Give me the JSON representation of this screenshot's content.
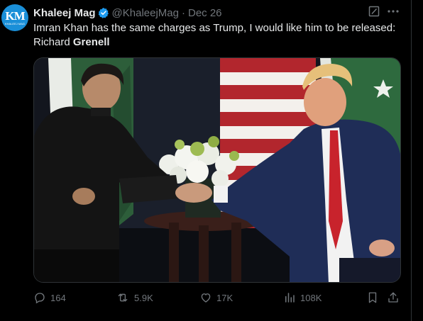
{
  "author": {
    "avatar_text": "KM",
    "avatar_subtext": "KHALEEJ MAG",
    "name": "Khaleej Mag",
    "handle": "@KhaleejMag",
    "separator": "·",
    "date": "Dec 26"
  },
  "tweet": {
    "text_line1": "Imran Khan has the same charges as Trump, I would like him to be released:",
    "text_line2_plain": "Richard ",
    "text_line2_bold": "Grenell"
  },
  "icons": {
    "grok": "grok-icon",
    "more": "more-icon",
    "verified": "verified-badge-icon"
  },
  "actions": {
    "replies": "164",
    "reposts": "5.9K",
    "likes": "17K",
    "views": "108K"
  },
  "colors": {
    "background": "#000000",
    "text": "#e7e9ea",
    "secondary": "#71767b",
    "verified": "#1d9bf0",
    "avatar": "#1a8fd8"
  }
}
